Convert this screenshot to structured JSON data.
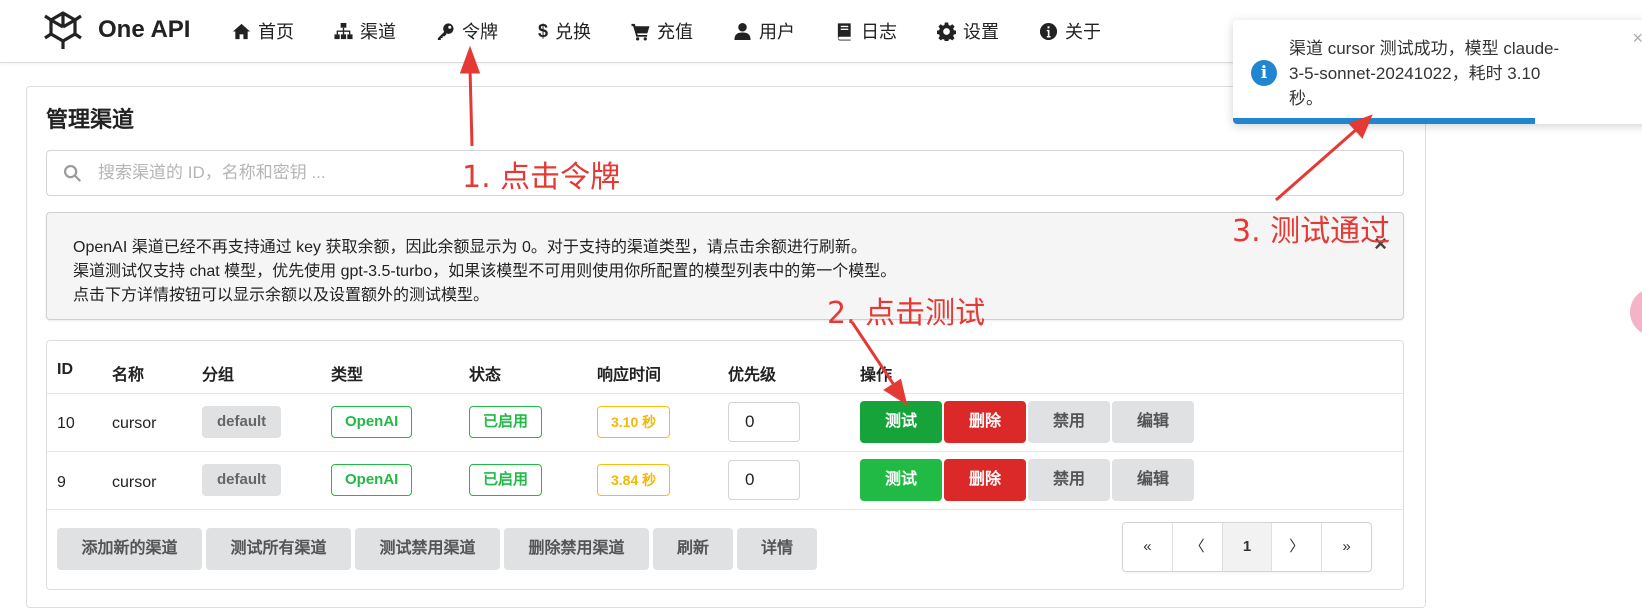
{
  "header": {
    "brand": "One API",
    "nav": [
      {
        "label": "首页",
        "icon": "home-icon"
      },
      {
        "label": "渠道",
        "icon": "sitemap-icon"
      },
      {
        "label": "令牌",
        "icon": "key-icon"
      },
      {
        "label": "兑换",
        "icon": "dollar-icon"
      },
      {
        "label": "充值",
        "icon": "cart-icon"
      },
      {
        "label": "用户",
        "icon": "user-icon"
      },
      {
        "label": "日志",
        "icon": "book-icon"
      },
      {
        "label": "设置",
        "icon": "gear-icon"
      },
      {
        "label": "关于",
        "icon": "info-icon"
      }
    ]
  },
  "page": {
    "title": "管理渠道",
    "search_placeholder": "搜索渠道的 ID，名称和密钥 ..."
  },
  "notice": {
    "lines": [
      "OpenAI 渠道已经不再支持通过 key 获取余额，因此余额显示为 0。对于支持的渠道类型，请点击余额进行刷新。",
      "渠道测试仅支持 chat 模型，优先使用 gpt-3.5-turbo，如果该模型不可用则使用你所配置的模型列表中的第一个模型。",
      "点击下方详情按钮可以显示余额以及设置额外的测试模型。"
    ],
    "close": "×"
  },
  "table": {
    "headers": [
      "ID",
      "名称",
      "分组",
      "类型",
      "状态",
      "响应时间",
      "优先级",
      "操作"
    ],
    "rows": [
      {
        "id": "10",
        "name": "cursor",
        "group": "default",
        "type": "OpenAI",
        "status": "已启用",
        "response": "3.10 秒",
        "priority": "0"
      },
      {
        "id": "9",
        "name": "cursor",
        "group": "default",
        "type": "OpenAI",
        "status": "已启用",
        "response": "3.84 秒",
        "priority": "0"
      }
    ],
    "actions": {
      "test": "测试",
      "delete": "删除",
      "disable": "禁用",
      "edit": "编辑"
    }
  },
  "footer_buttons": [
    "添加新的渠道",
    "测试所有渠道",
    "测试禁用渠道",
    "删除禁用渠道",
    "刷新",
    "详情"
  ],
  "pagination": [
    "«",
    "〈",
    "1",
    "〉",
    "»"
  ],
  "toast": {
    "lines": [
      "渠道 cursor 测试成功，模型 claude-",
      "3-5-sonnet-20241022，耗时 3.10",
      "秒。"
    ],
    "close": "×",
    "progress": 0.72
  },
  "annotations": {
    "step1": "1. 点击令牌",
    "step2": "2. 点击测试",
    "step3": "3. 测试通过"
  },
  "colors": {
    "green": "#21ba45",
    "red": "#db2828",
    "yellow": "#fbbd08",
    "blue": "#2185d0",
    "annotation": "#e53935"
  }
}
